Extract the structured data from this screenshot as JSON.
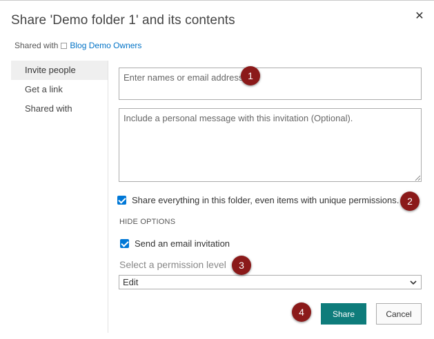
{
  "dialog": {
    "title": "Share 'Demo folder 1' and its contents",
    "close_glyph": "✕",
    "shared_with_prefix": "Shared with",
    "shared_with_link": "Blog Demo Owners"
  },
  "sidebar": {
    "items": [
      {
        "label": "Invite people",
        "active": true
      },
      {
        "label": "Get a link",
        "active": false
      },
      {
        "label": "Shared with",
        "active": false
      }
    ]
  },
  "form": {
    "names_placeholder": "Enter names or email addresses...",
    "message_placeholder": "Include a personal message with this invitation (Optional).",
    "share_everything_label": "Share everything in this folder, even items with unique permissions.",
    "share_everything_checked": true,
    "hide_options_label": "HIDE OPTIONS",
    "send_email_label": "Send an email invitation",
    "send_email_checked": true,
    "permission_label": "Select a permission level",
    "permission_value": "Edit"
  },
  "buttons": {
    "share_label": "Share",
    "cancel_label": "Cancel"
  },
  "callouts": [
    "1",
    "2",
    "3",
    "4"
  ],
  "colors": {
    "accent": "#0078d7",
    "share_button": "#0e7c7b",
    "callout": "#8b1a1a"
  }
}
